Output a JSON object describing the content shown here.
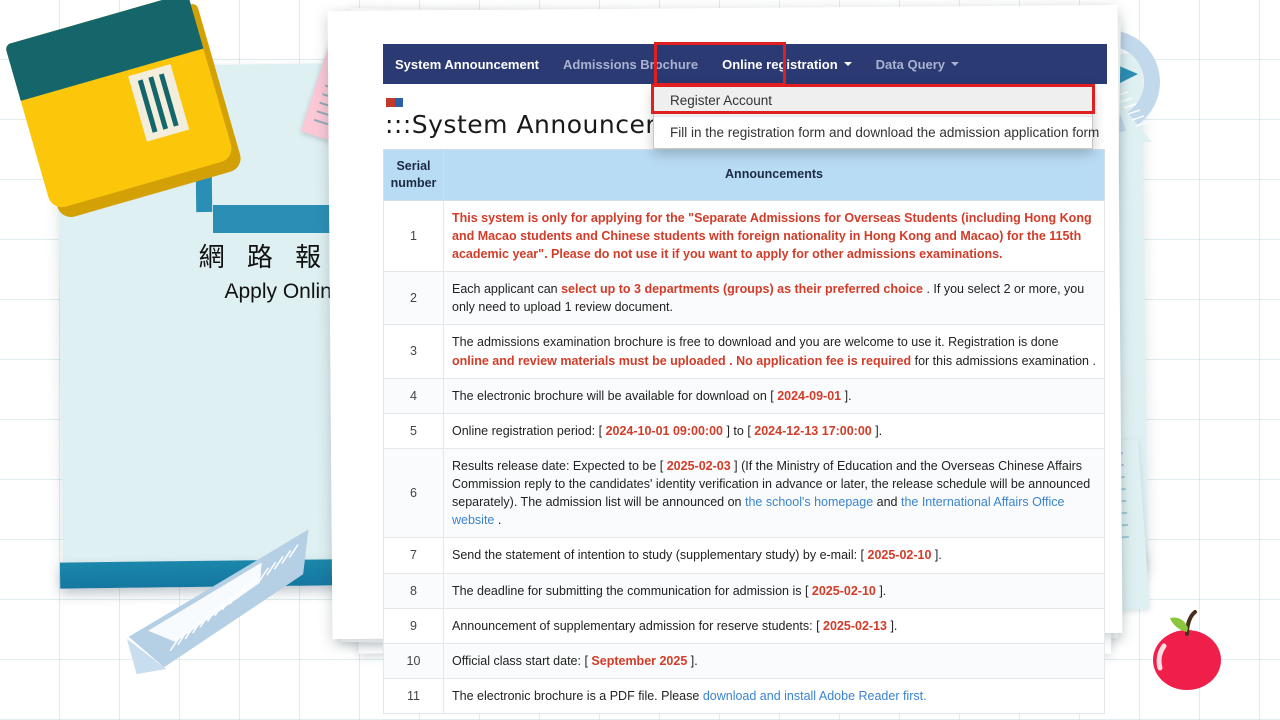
{
  "decor": {
    "book": "book-icon",
    "notepad": "notepad-icon",
    "triangle_ruler": "triangle-ruler-icon",
    "protractor": "protractor-icon",
    "ruler": "ruler-icon",
    "apple": "apple-icon"
  },
  "left_panel": {
    "title_zh": "網 路 報 名",
    "title_en": "Apply Online"
  },
  "nav": {
    "brand_color": "#2b3a73",
    "items": [
      {
        "label": "System Announcement",
        "active": true,
        "caret": false
      },
      {
        "label": "Admissions Brochure",
        "active": false,
        "caret": false
      },
      {
        "label": "Online registration",
        "active": true,
        "caret": true
      },
      {
        "label": "Data Query",
        "active": false,
        "caret": true
      }
    ]
  },
  "dropdown": {
    "open_for": "Online registration",
    "items": [
      {
        "label": "Register Account",
        "highlighted": true
      },
      {
        "label": "Fill in the registration form and download the admission application form",
        "highlighted": false
      }
    ]
  },
  "highlight_color": "#e02020",
  "page": {
    "title": ":::System Announceme"
  },
  "table": {
    "columns": [
      "Serial number",
      "Announcements"
    ],
    "rows": [
      {
        "sn": "1",
        "emphasis": "full",
        "parts": [
          {
            "t": "This system is only for applying for the \"Separate Admissions for Overseas Students (including Hong Kong and Macao students and Chinese students with foreign nationality in Hong Kong and Macao) for the 115th academic year\". Please do not use it if you want to apply for other admissions examinations.",
            "s": "red-bold"
          }
        ]
      },
      {
        "sn": "2",
        "parts": [
          {
            "t": "Each applicant can ",
            "s": "plain"
          },
          {
            "t": "select up to 3 departments (groups) as their preferred choice",
            "s": "red-bold"
          },
          {
            "t": " . If you select 2 or more, you only need to upload 1 review document.",
            "s": "plain"
          }
        ]
      },
      {
        "sn": "3",
        "parts": [
          {
            "t": "The admissions examination brochure is free to download and you are welcome to use it. Registration is done  ",
            "s": "plain"
          },
          {
            "t": "online and review materials must be uploaded . No application fee is required",
            "s": "red-bold"
          },
          {
            "t": " for this admissions examination  .",
            "s": "plain"
          }
        ]
      },
      {
        "sn": "4",
        "parts": [
          {
            "t": "The electronic brochure will be available for download on [ ",
            "s": "plain"
          },
          {
            "t": "2024-09-01",
            "s": "red-bold"
          },
          {
            "t": " ].",
            "s": "plain"
          }
        ]
      },
      {
        "sn": "5",
        "parts": [
          {
            "t": "Online registration period: [ ",
            "s": "plain"
          },
          {
            "t": "2024-10-01 09:00:00",
            "s": "red-bold"
          },
          {
            "t": " ] to [ ",
            "s": "plain"
          },
          {
            "t": "2024-12-13 17:00:00",
            "s": "red-bold"
          },
          {
            "t": " ].",
            "s": "plain"
          }
        ]
      },
      {
        "sn": "6",
        "parts": [
          {
            "t": "Results release date: Expected to be [ ",
            "s": "plain"
          },
          {
            "t": "2025-02-03",
            "s": "red-bold"
          },
          {
            "t": " ] (If the Ministry of Education and the Overseas Chinese Affairs Commission reply to the candidates' identity verification in advance or later, the release schedule will be announced separately). The admission list will be announced on ",
            "s": "plain"
          },
          {
            "t": "the school's homepage",
            "s": "link"
          },
          {
            "t": " and ",
            "s": "plain"
          },
          {
            "t": "the International Affairs Office website",
            "s": "link"
          },
          {
            "t": " .",
            "s": "plain"
          }
        ]
      },
      {
        "sn": "7",
        "parts": [
          {
            "t": "Send the statement of intention to study (supplementary study) by e-mail: [ ",
            "s": "plain"
          },
          {
            "t": "2025-02-10",
            "s": "red-bold"
          },
          {
            "t": " ].",
            "s": "plain"
          }
        ]
      },
      {
        "sn": "8",
        "parts": [
          {
            "t": "The deadline for submitting the communication for admission is [ ",
            "s": "plain"
          },
          {
            "t": "2025-02-10",
            "s": "red-bold"
          },
          {
            "t": " ].",
            "s": "plain"
          }
        ]
      },
      {
        "sn": "9",
        "parts": [
          {
            "t": "Announcement of supplementary admission for reserve students: [ ",
            "s": "plain"
          },
          {
            "t": "2025-02-13",
            "s": "red-bold"
          },
          {
            "t": " ].",
            "s": "plain"
          }
        ]
      },
      {
        "sn": "10",
        "parts": [
          {
            "t": "Official class start date: [ ",
            "s": "plain"
          },
          {
            "t": "September 2025",
            "s": "red-bold"
          },
          {
            "t": " ].",
            "s": "plain"
          }
        ]
      },
      {
        "sn": "11",
        "parts": [
          {
            "t": "The electronic brochure is a PDF file. Please ",
            "s": "plain"
          },
          {
            "t": "download and install Adobe Reader first.",
            "s": "link"
          }
        ]
      }
    ]
  }
}
